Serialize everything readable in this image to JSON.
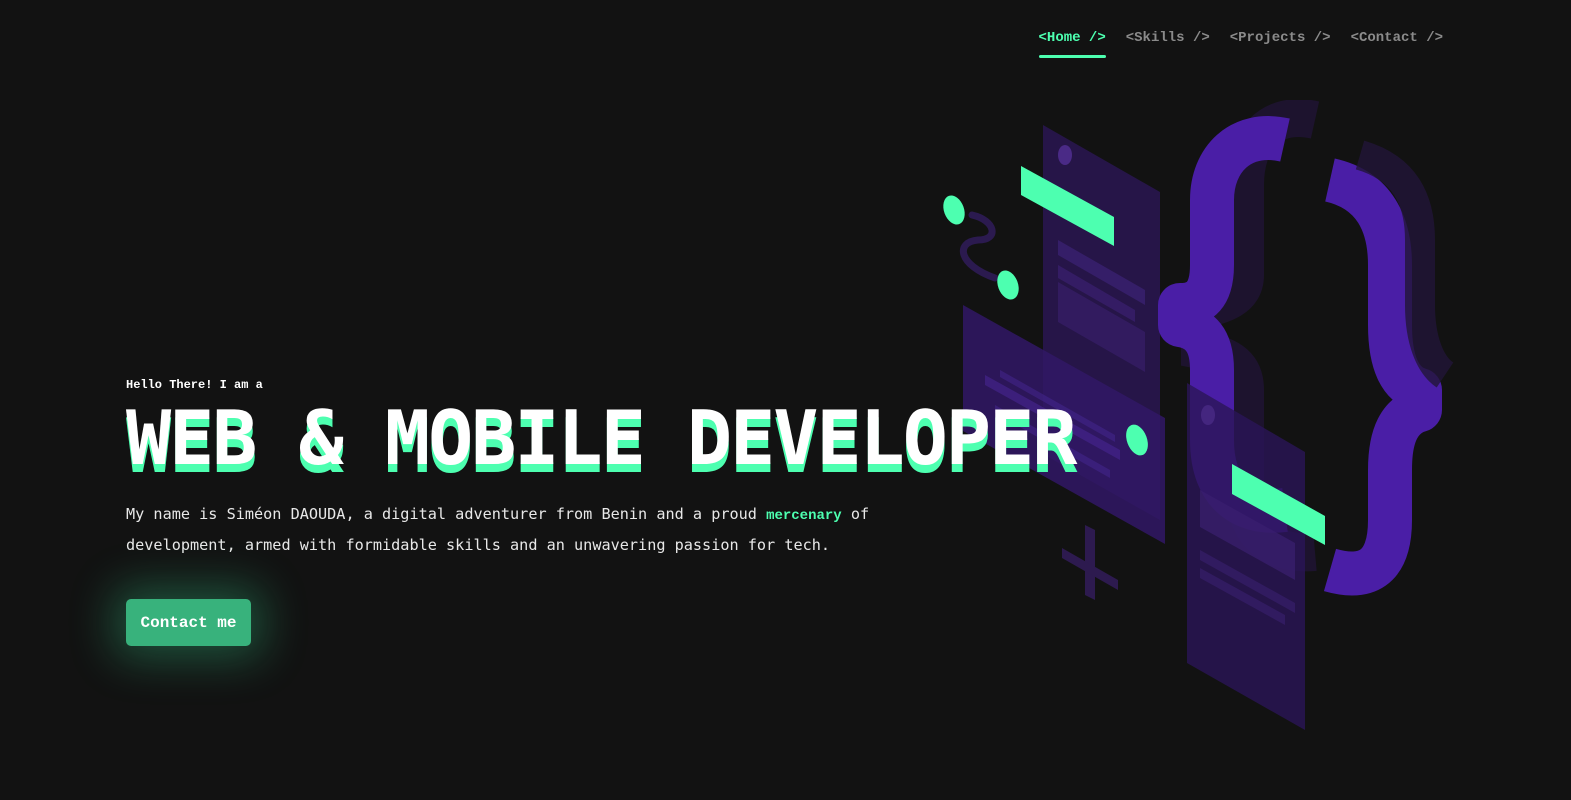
{
  "nav": {
    "items": [
      {
        "label": "<Home />",
        "active": true
      },
      {
        "label": "<Skills />",
        "active": false
      },
      {
        "label": "<Projects />",
        "active": false
      },
      {
        "label": "<Contact />",
        "active": false
      }
    ]
  },
  "hero": {
    "eyebrow": "Hello There! I am a",
    "headline": "WEB & MOBILE DEVELOPER",
    "intro_before": "My name is Siméon DAOUDA, a digital adventurer from Benin and a proud ",
    "intro_highlight": "mercenary",
    "intro_after": " of development, armed with formidable skills and an unwavering passion for tech."
  },
  "cta": {
    "label": "Contact me"
  },
  "illustration": {
    "icon": "isometric-code-braces-illustration"
  },
  "colors": {
    "background": "#121212",
    "accent": "#4dffb0",
    "button": "#38b27c",
    "purple": "#4b1fa8",
    "nav_inactive": "#8a8a8a"
  }
}
